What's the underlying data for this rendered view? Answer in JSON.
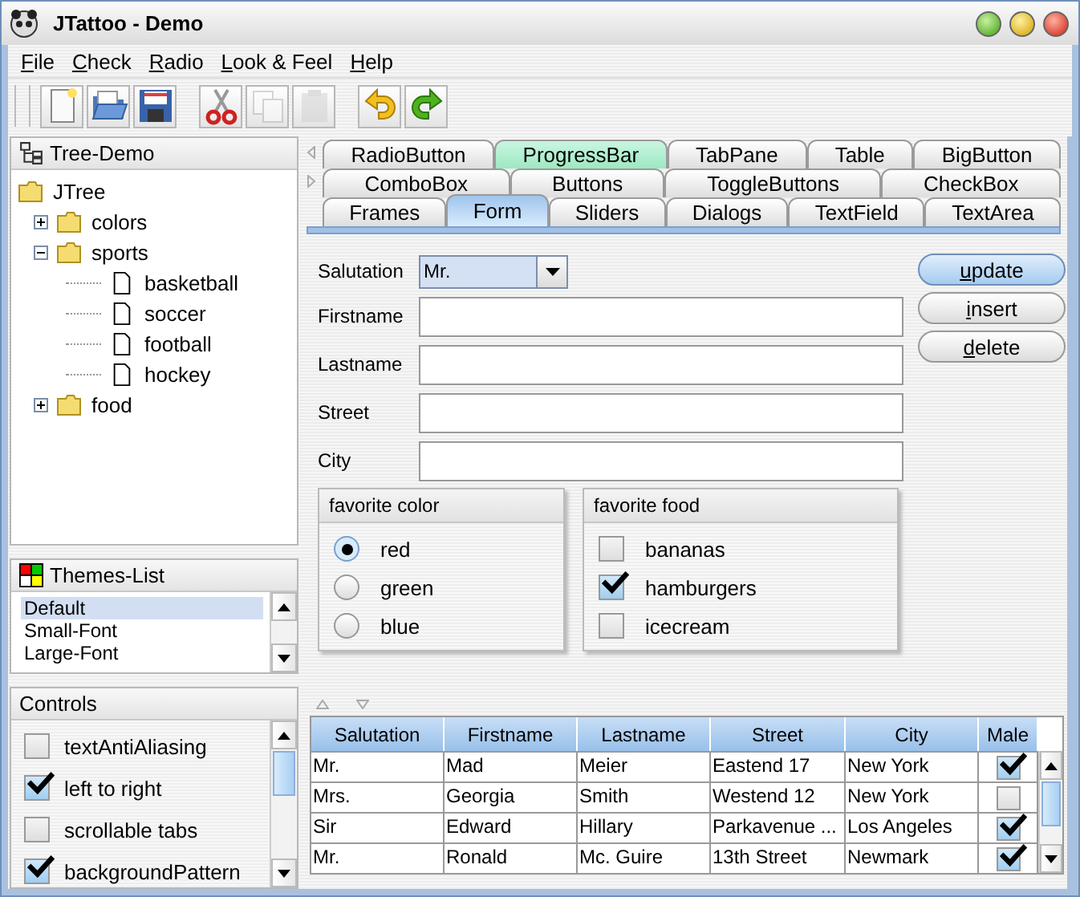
{
  "window": {
    "title": "JTattoo - Demo"
  },
  "menu": [
    {
      "label": "File"
    },
    {
      "label": "Check"
    },
    {
      "label": "Radio"
    },
    {
      "label": "Look & Feel"
    },
    {
      "label": "Help"
    }
  ],
  "toolbar": [
    {
      "kind": "new",
      "disabled": false
    },
    {
      "kind": "open",
      "disabled": false
    },
    {
      "kind": "save",
      "disabled": false
    },
    {
      "kind": "cut",
      "disabled": false
    },
    {
      "kind": "copy",
      "disabled": true
    },
    {
      "kind": "paste",
      "disabled": true
    },
    {
      "kind": "undo",
      "disabled": false
    },
    {
      "kind": "redo",
      "disabled": false
    }
  ],
  "tree": {
    "title": "Tree-Demo",
    "root": {
      "label": "JTree",
      "children": [
        {
          "label": "colors",
          "expanded": false
        },
        {
          "label": "sports",
          "expanded": true,
          "children": [
            {
              "label": "basketball"
            },
            {
              "label": "soccer"
            },
            {
              "label": "football"
            },
            {
              "label": "hockey"
            }
          ]
        },
        {
          "label": "food",
          "expanded": false
        }
      ]
    }
  },
  "themes": {
    "title": "Themes-List",
    "items": [
      {
        "label": "Default",
        "selected": true
      },
      {
        "label": "Small-Font",
        "selected": false
      },
      {
        "label": "Large-Font",
        "selected": false
      }
    ]
  },
  "controls": {
    "title": "Controls",
    "items": [
      {
        "label": "textAntiAliasing",
        "checked": false
      },
      {
        "label": "left to right",
        "checked": true
      },
      {
        "label": "scrollable tabs",
        "checked": false
      },
      {
        "label": "backgroundPattern",
        "checked": true
      }
    ]
  },
  "tabs": [
    [
      {
        "label": "RadioButton",
        "selected": false,
        "highlighted": false
      },
      {
        "label": "ProgressBar",
        "selected": false,
        "highlighted": true
      },
      {
        "label": "TabPane",
        "selected": false,
        "highlighted": false
      },
      {
        "label": "Table",
        "selected": false,
        "highlighted": false
      },
      {
        "label": "BigButton",
        "selected": false,
        "highlighted": false
      }
    ],
    [
      {
        "label": "ComboBox",
        "selected": false,
        "highlighted": false
      },
      {
        "label": "Buttons",
        "selected": false,
        "highlighted": false
      },
      {
        "label": "ToggleButtons",
        "selected": false,
        "highlighted": false
      },
      {
        "label": "CheckBox",
        "selected": false,
        "highlighted": false
      }
    ],
    [
      {
        "label": "Frames",
        "selected": false,
        "highlighted": false
      },
      {
        "label": "Form",
        "selected": true,
        "highlighted": false
      },
      {
        "label": "Sliders",
        "selected": false,
        "highlighted": false
      },
      {
        "label": "Dialogs",
        "selected": false,
        "highlighted": false
      },
      {
        "label": "TextField",
        "selected": false,
        "highlighted": false
      },
      {
        "label": "TextArea",
        "selected": false,
        "highlighted": false
      }
    ]
  ],
  "form": {
    "fields": [
      {
        "label": "Salutation",
        "kind": "combo",
        "value": "Mr."
      },
      {
        "label": "Firstname",
        "kind": "text"
      },
      {
        "label": "Lastname",
        "kind": "text"
      },
      {
        "label": "Street",
        "kind": "text"
      },
      {
        "label": "City",
        "kind": "text"
      }
    ],
    "buttons": [
      {
        "label": "update",
        "default": true
      },
      {
        "label": "insert",
        "default": false
      },
      {
        "label": "delete",
        "default": false
      }
    ],
    "color_group": {
      "title": "favorite color",
      "options": [
        {
          "label": "red",
          "selected": true
        },
        {
          "label": "green",
          "selected": false
        },
        {
          "label": "blue",
          "selected": false
        }
      ]
    },
    "food_group": {
      "title": "favorite food",
      "options": [
        {
          "label": "bananas",
          "checked": false
        },
        {
          "label": "hamburgers",
          "checked": true
        },
        {
          "label": "icecream",
          "checked": false
        }
      ]
    }
  },
  "table": {
    "columns": [
      "Salutation",
      "Firstname",
      "Lastname",
      "Street",
      "City",
      "Male"
    ],
    "rows": [
      {
        "cells": [
          "Mr.",
          "Mad",
          "Meier",
          "Eastend 17",
          "New York"
        ],
        "male": true
      },
      {
        "cells": [
          "Mrs.",
          "Georgia",
          "Smith",
          "Westend 12",
          "New York"
        ],
        "male": false
      },
      {
        "cells": [
          "Sir",
          "Edward",
          "Hillary",
          "Parkavenue ...",
          "Los Angeles"
        ],
        "male": true
      },
      {
        "cells": [
          "Mr.",
          "Ronald",
          "Mc. Guire",
          "13th Street",
          "Newmark"
        ],
        "male": true
      }
    ]
  }
}
